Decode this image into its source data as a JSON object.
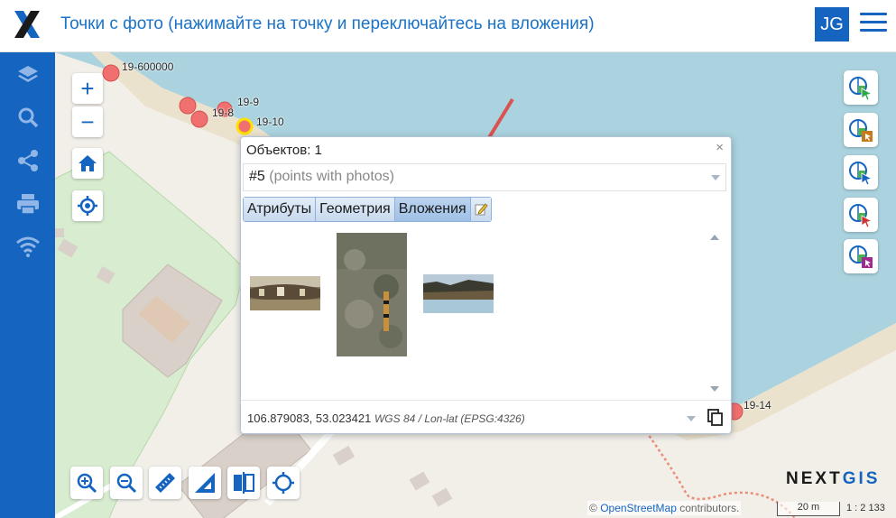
{
  "header": {
    "title": "Точки с фото (нажимайте на точку и переключайтесь на вложения)",
    "avatar_initials": "JG"
  },
  "sidebar": {
    "items": [
      {
        "name": "layers-icon"
      },
      {
        "name": "search-icon"
      },
      {
        "name": "share-icon"
      },
      {
        "name": "print-icon"
      },
      {
        "name": "wifi-icon"
      }
    ]
  },
  "map": {
    "point_labels": [
      "19-600000",
      "19-9",
      "19-8",
      "19-10",
      "19-14"
    ],
    "controls": {
      "zoom_in": "+",
      "zoom_out": "−"
    }
  },
  "popup": {
    "objects_label": "Объектов: 1",
    "feature_id": "#5",
    "feature_layer": "(points with photos)",
    "close_symbol": "×",
    "tabs": [
      "Атрибуты",
      "Геометрия",
      "Вложения"
    ],
    "active_tab": "Вложения",
    "coords_value": "106.879083, 53.023421",
    "coords_crs": "WGS 84 / Lon-lat (EPSG:4326)"
  },
  "footer": {
    "brand_next": "NEXT",
    "brand_gis": "GIS",
    "attribution_prefix": "©",
    "attribution_link": "OpenStreetMap",
    "attribution_suffix": "contributors.",
    "scale_label": "20 m",
    "scale_ratio": "1 : 2 133"
  },
  "colors": {
    "brand_blue": "#1565c0",
    "point_red": "#f07070",
    "arrow": "#d9534f"
  }
}
